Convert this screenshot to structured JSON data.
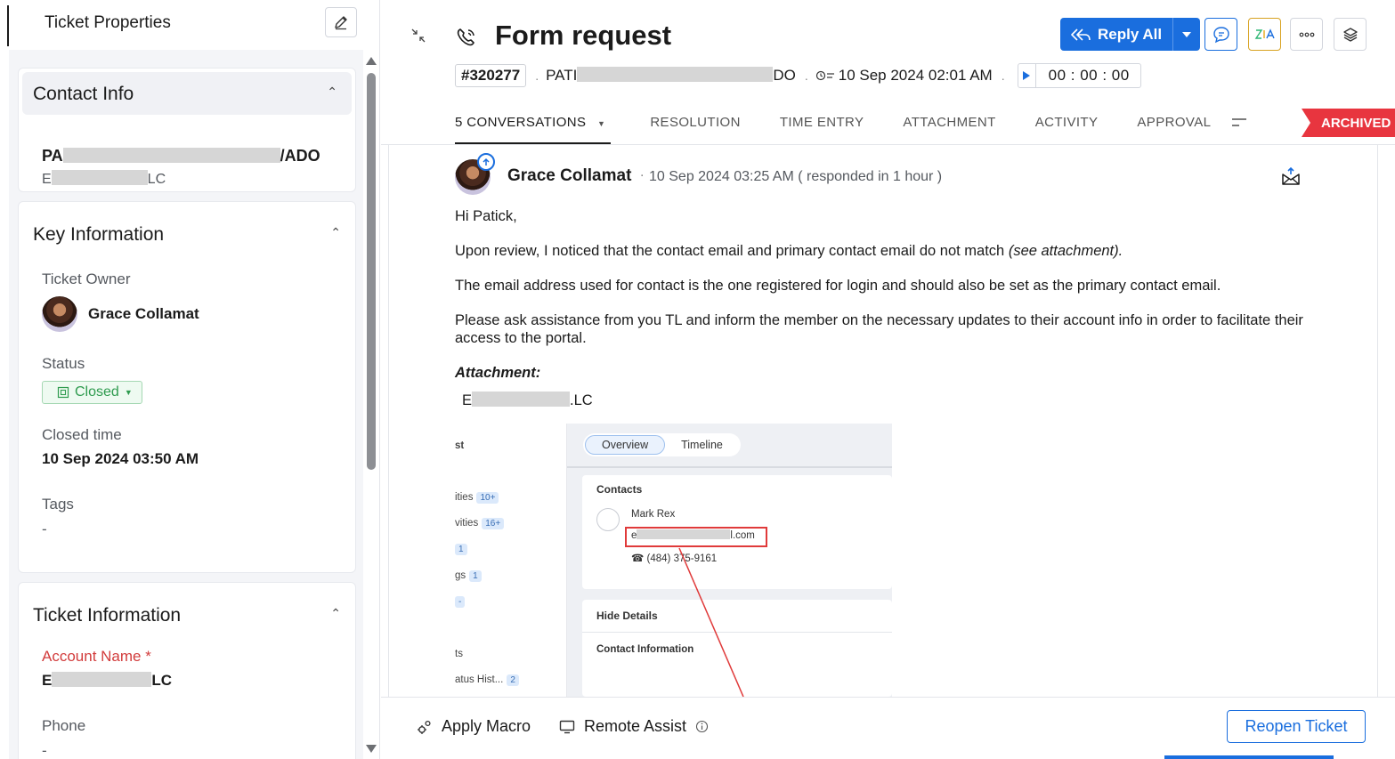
{
  "properties": {
    "title": "Ticket Properties",
    "contact_info": {
      "title": "Contact Info",
      "name_start": "PA",
      "name_end": "/ADO",
      "account_start": "E",
      "account_end": "LC"
    },
    "key_information": {
      "title": "Key Information",
      "owner_label": "Ticket Owner",
      "owner_name": "Grace Collamat",
      "status_label": "Status",
      "status_value": "Closed",
      "closed_time_label": "Closed time",
      "closed_time_value": "10 Sep 2024 03:50 AM",
      "tags_label": "Tags",
      "tags_value": "-"
    },
    "ticket_information": {
      "title": "Ticket Information",
      "account_name_label": "Account Name *",
      "account_start": "E",
      "account_end": "LC",
      "phone_label": "Phone",
      "phone_value": "-"
    }
  },
  "ticket": {
    "title": "Form request",
    "id": "#320277",
    "contact_start": "PATI",
    "contact_end": "DO",
    "created_time": "10 Sep 2024 02:01 AM",
    "timer": "00 : 00 : 00"
  },
  "toolbar": {
    "reply_all_label": "Reply All"
  },
  "tabs": [
    {
      "label": "5 CONVERSATIONS"
    },
    {
      "label": "RESOLUTION"
    },
    {
      "label": "TIME ENTRY"
    },
    {
      "label": "ATTACHMENT"
    },
    {
      "label": "ACTIVITY"
    },
    {
      "label": "APPROVAL"
    }
  ],
  "archived_label": "ARCHIVED",
  "conversation": {
    "sender": "Grace Collamat",
    "time": "10 Sep 2024 03:25 AM ( responded in 1 hour )",
    "greeting": "Hi Patick,",
    "para1_main": "Upon review, I noticed that the contact email and primary contact email do not match ",
    "para1_italic": "(see attachment).",
    "para2": "The email address used for contact is the one registered for login and should also be set as the primary contact email.",
    "para3": "Please ask assistance from you TL and inform the member on the necessary updates to their account info in order to facilitate their access to the portal.",
    "attachment_label": "Attachment:",
    "attachment_start": "E",
    "attachment_end": ".LC"
  },
  "embedded": {
    "left_items": [
      {
        "text": "st",
        "badge": ""
      },
      {
        "text": "ities",
        "badge": "10+"
      },
      {
        "text": "vities",
        "badge": "16+"
      },
      {
        "text": "",
        "badge": "1"
      },
      {
        "text": "gs",
        "badge": "1"
      },
      {
        "text": "",
        "badge": "-"
      },
      {
        "text": "ts",
        "badge": ""
      },
      {
        "text": "atus Hist...",
        "badge": "2"
      }
    ],
    "tab_overview": "Overview",
    "tab_timeline": "Timeline",
    "contacts_label": "Contacts",
    "contact_name": "Mark Rex",
    "email_start": "e",
    "email_end": "l.com",
    "phone": "(484) 375-9161",
    "hide_details": "Hide Details",
    "contact_information": "Contact Information"
  },
  "bottom": {
    "apply_macro": "Apply Macro",
    "remote_assist": "Remote Assist",
    "reopen": "Reopen Ticket"
  },
  "colors": {
    "accent": "#1a6ede",
    "archived": "#e8353f",
    "status_closed": "#2f9b4f",
    "required_label": "#d23c3c"
  }
}
